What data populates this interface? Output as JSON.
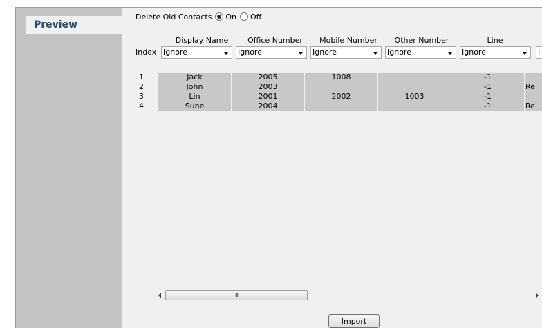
{
  "sidebar": {
    "tab_label": "Preview"
  },
  "delete_old_contacts": {
    "label": "Delete Old Contacts",
    "options": [
      {
        "label": "On",
        "checked": true
      },
      {
        "label": "Off",
        "checked": false
      }
    ]
  },
  "index_label": "Index",
  "columns": [
    {
      "header": "Display Name",
      "mapping": "Ignore"
    },
    {
      "header": "Office Number",
      "mapping": "Ignore"
    },
    {
      "header": "Mobile Number",
      "mapping": "Ignore"
    },
    {
      "header": "Other Number",
      "mapping": "Ignore"
    },
    {
      "header": "Line",
      "mapping": "Ignore"
    },
    {
      "header": "",
      "mapping": "I"
    }
  ],
  "rows": [
    {
      "index": "1",
      "cells": [
        "Jack",
        "2005",
        "1008",
        "",
        "-1",
        ""
      ]
    },
    {
      "index": "2",
      "cells": [
        "John",
        "2003",
        "",
        "",
        "-1",
        "Re"
      ]
    },
    {
      "index": "3",
      "cells": [
        "Lin",
        "2001",
        "2002",
        "1003",
        "-1",
        ""
      ]
    },
    {
      "index": "4",
      "cells": [
        "Sune",
        "2004",
        "",
        "",
        "-1",
        "Re"
      ]
    }
  ],
  "scrollbar": {
    "thumb_grip": "III"
  },
  "import_label": "Import"
}
